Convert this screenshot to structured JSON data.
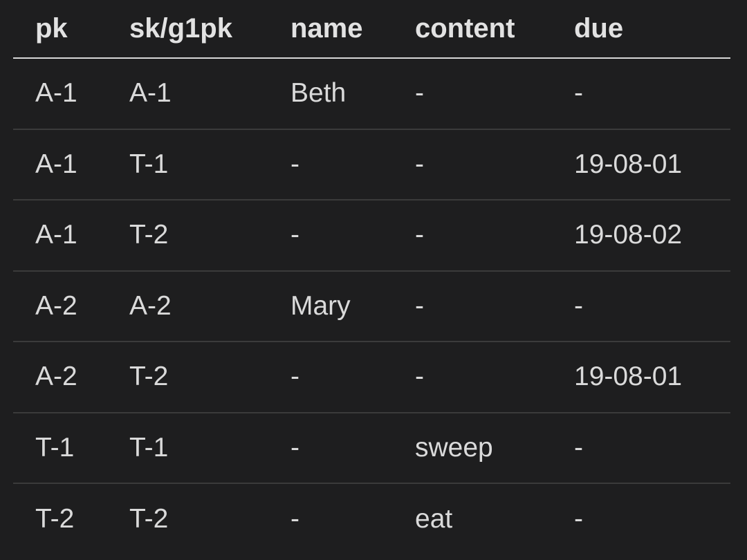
{
  "table": {
    "headers": [
      "pk",
      "sk/g1pk",
      "name",
      "content",
      "due"
    ],
    "rows": [
      [
        "A-1",
        "A-1",
        "Beth",
        "-",
        "-"
      ],
      [
        "A-1",
        "T-1",
        "-",
        "-",
        "19-08-01"
      ],
      [
        "A-1",
        "T-2",
        "-",
        "-",
        "19-08-02"
      ],
      [
        "A-2",
        "A-2",
        "Mary",
        "-",
        "-"
      ],
      [
        "A-2",
        "T-2",
        "-",
        "-",
        "19-08-01"
      ],
      [
        "T-1",
        "T-1",
        "-",
        "sweep",
        "-"
      ],
      [
        "T-2",
        "T-2",
        "-",
        "eat",
        "-"
      ]
    ]
  }
}
